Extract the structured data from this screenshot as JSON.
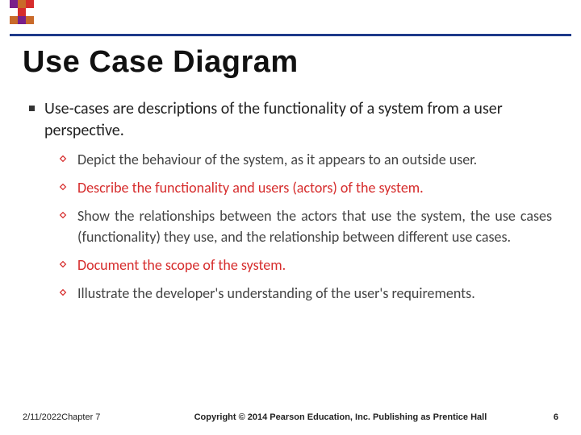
{
  "title": "Use Case Diagram",
  "main_bullet": "Use-cases are descriptions of the functionality of a system from a user perspective.",
  "sub_bullets": [
    {
      "text": "Depict the behaviour of the system, as it appears to an outside user.",
      "red": false
    },
    {
      "text": "Describe the functionality and users (actors) of the system.",
      "red": true
    },
    {
      "text": "Show the relationships between the actors that use the system, the use cases (functionality) they use, and the relationship between different use cases.",
      "red": false
    },
    {
      "text": "Document the scope of the system.",
      "red": true
    },
    {
      "text": "Illustrate the developer's understanding of the user's requirements.",
      "red": false
    }
  ],
  "footer": {
    "date": "2/11/2022Chapter 7",
    "copyright": "Copyright © 2014 Pearson Education, Inc. Publishing as Prentice Hall",
    "page": "6"
  }
}
